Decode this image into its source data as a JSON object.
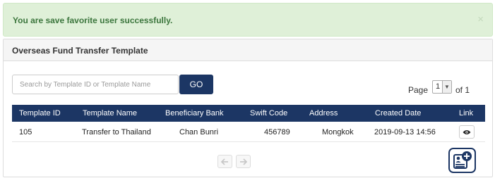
{
  "alert": {
    "message": "You are save favorite user successfully.",
    "close_icon": "×"
  },
  "panel": {
    "title": "Overseas Fund Transfer Template"
  },
  "search": {
    "placeholder": "Search by Template ID or Template Name",
    "value": "",
    "go_label": "GO"
  },
  "pager": {
    "page_label": "Page",
    "current": "1",
    "of_label": "of 1"
  },
  "table": {
    "headers": [
      "Template ID",
      "Template Name",
      "Beneficiary Bank",
      "Swift Code",
      "Address",
      "Created Date",
      "Link"
    ],
    "rows": [
      [
        "105",
        "Transfer to Thailand",
        "Chan Bunri",
        "456789",
        "Mongkok",
        "2019-09-13 14:56"
      ]
    ]
  },
  "icons": {
    "view": "eye-icon",
    "prev": "arrow-left-icon",
    "next": "arrow-right-icon",
    "add": "add-template-icon"
  },
  "colors": {
    "primary": "#1c3664",
    "alert_bg": "#dff0d8",
    "alert_text": "#3c763d"
  }
}
